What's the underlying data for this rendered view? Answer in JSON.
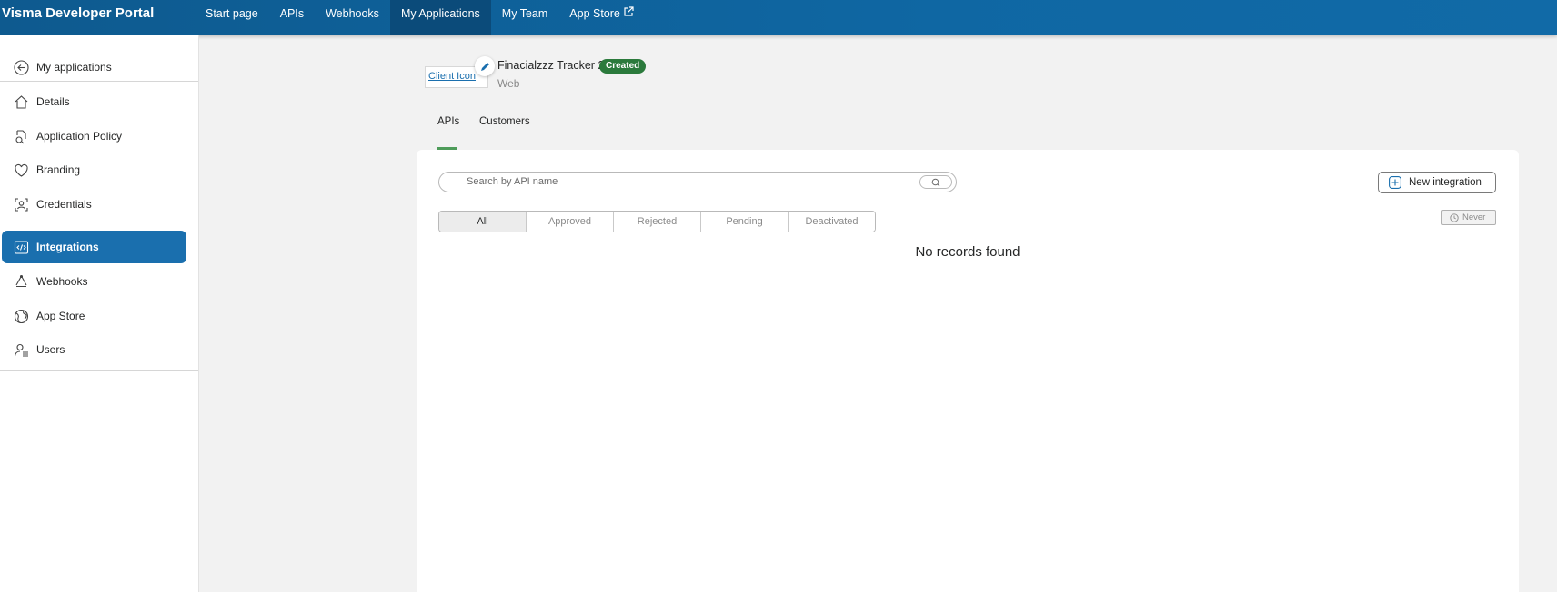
{
  "header": {
    "brand": "Visma Developer Portal",
    "nav": [
      {
        "label": "Start page"
      },
      {
        "label": "APIs"
      },
      {
        "label": "Webhooks"
      },
      {
        "label": "My Applications",
        "active": true
      },
      {
        "label": "My Team"
      },
      {
        "label": "App Store",
        "external": true
      }
    ]
  },
  "sidebar": {
    "back_label": "My applications",
    "items": [
      {
        "label": "Details",
        "icon": "home-icon"
      },
      {
        "label": "Application Policy",
        "icon": "policy-icon"
      },
      {
        "label": "Branding",
        "icon": "heart-icon"
      },
      {
        "label": "Credentials",
        "icon": "credentials-icon"
      },
      {
        "label": "Integrations",
        "icon": "code-icon",
        "active": true
      },
      {
        "label": "Webhooks",
        "icon": "webhooks-icon"
      },
      {
        "label": "App Store",
        "icon": "globe-icon"
      },
      {
        "label": "Users",
        "icon": "users-icon"
      }
    ]
  },
  "app": {
    "icon_alt": "Client Icon",
    "name": "Finacialzzz Tracker 2",
    "status": "Created",
    "type": "Web"
  },
  "tabs": [
    {
      "label": "APIs",
      "active": true
    },
    {
      "label": "Customers"
    }
  ],
  "panel": {
    "search_placeholder": "Search  by API name",
    "new_integration_label": "New integration",
    "filters": [
      {
        "label": "All",
        "active": true
      },
      {
        "label": "Approved"
      },
      {
        "label": "Rejected"
      },
      {
        "label": "Pending"
      },
      {
        "label": "Deactivated"
      }
    ],
    "refresh_label": "Never",
    "empty_message": "No records found"
  },
  "colors": {
    "topbar": "#0f67a3",
    "active_sidebar": "#1a6fae",
    "status_badge": "#2b7a3c",
    "tab_underline": "#4e9c5a"
  }
}
